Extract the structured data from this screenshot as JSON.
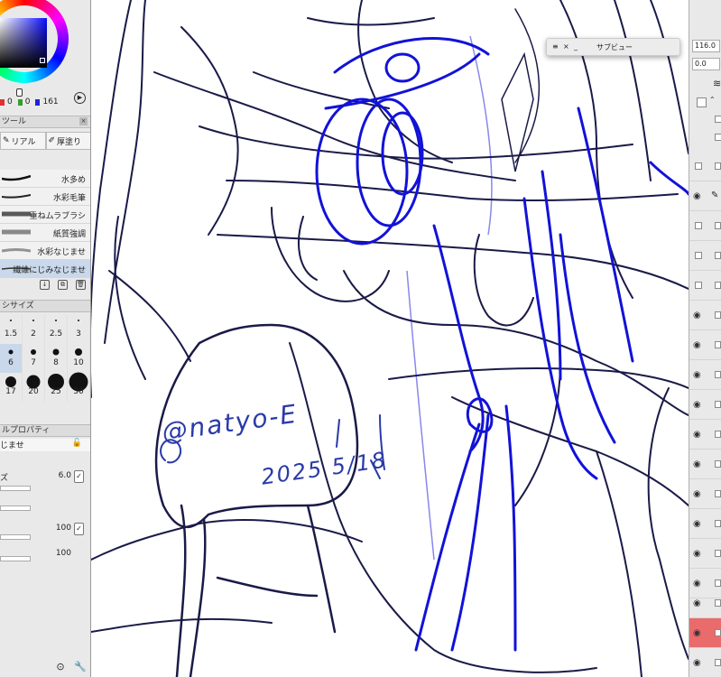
{
  "color_panel": {
    "r": "0",
    "g": "0",
    "b": "161",
    "colors": {
      "r": "#e03030",
      "g": "#30a030",
      "b": "#2020e0",
      "current": "#0c0c8c"
    }
  },
  "tool_panel": {
    "tab_label": "ツール",
    "tools": [
      {
        "icon": "pencil-icon",
        "label": "リアル"
      },
      {
        "icon": "brush-icon",
        "label": "厚塗り"
      }
    ]
  },
  "brushes": [
    {
      "label": "水多め"
    },
    {
      "label": "水彩毛筆"
    },
    {
      "label": "重ねムラブラシ"
    },
    {
      "label": "紙質強調"
    },
    {
      "label": "水彩なじませ"
    },
    {
      "label": "繊維にじみなじませ",
      "selected": true
    }
  ],
  "brush_size_panel": {
    "tab_label": "シサイズ",
    "rows": [
      [
        "1.5",
        "2",
        "2.5",
        "3"
      ],
      [
        "6",
        "7",
        "8",
        "10"
      ],
      [
        "17",
        "20",
        "25",
        "30"
      ]
    ],
    "selected": "6"
  },
  "tool_property": {
    "tab_label": "ルプロパティ",
    "tool_name": "じませ",
    "size_label": "ズ",
    "size_value": "6.0",
    "value_2": "100",
    "value_3": "100"
  },
  "sub_view": {
    "title": "サブビュー"
  },
  "right_panel": {
    "zoom_value": "116.0",
    "angle_value": "0.0"
  },
  "canvas": {
    "signature_handle": "@natyo-E",
    "signature_date": "2025 5/18"
  }
}
